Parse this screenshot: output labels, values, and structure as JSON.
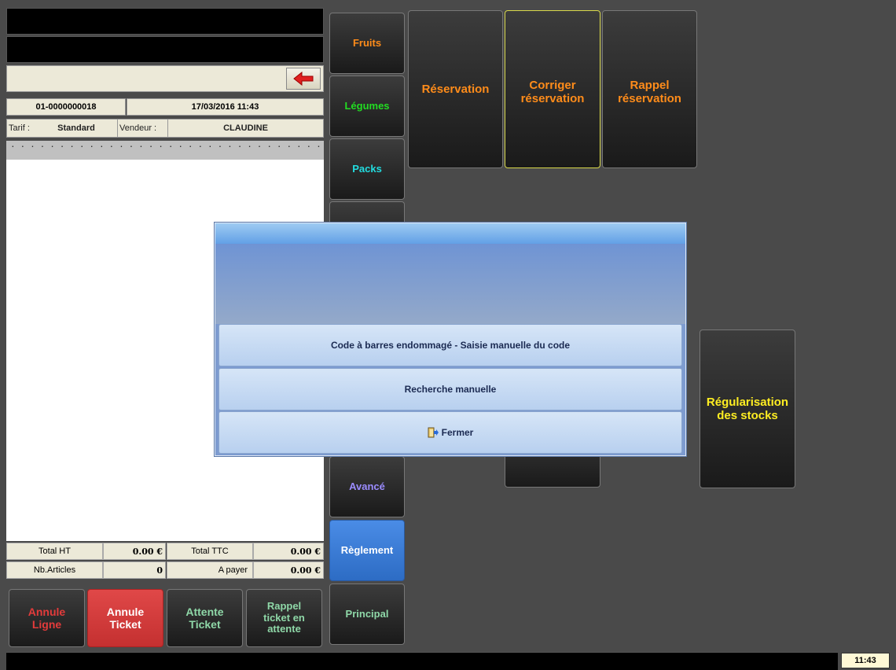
{
  "ticket": {
    "number": "01-0000000018",
    "datetime": "17/03/2016 11:43",
    "tarif_label": "Tarif :",
    "tarif_value": "Standard",
    "vendeur_label": "Vendeur :",
    "vendeur_value": "CLAUDINE",
    "dots": "· · · · · · · · · · · · · · · · · · · · · · · · · · · · · · · · · · · · · · ·"
  },
  "totals": {
    "total_ht_label": "Total HT",
    "total_ht_value": "0.00 €",
    "total_ttc_label": "Total TTC",
    "total_ttc_value": "0.00 €",
    "nb_articles_label": "Nb.Articles",
    "nb_articles_value": "0",
    "a_payer_label": "A payer",
    "a_payer_value": "0.00 €"
  },
  "bottom_buttons": {
    "annule_ligne": "Annule Ligne",
    "annule_ticket": "Annule Ticket",
    "attente_ticket": "Attente Ticket",
    "rappel_ticket": "Rappel ticket en attente"
  },
  "categories": {
    "fruits": "Fruits",
    "legumes": "Légumes",
    "packs": "Packs",
    "avance": "Avancé",
    "reglement": "Règlement",
    "principal": "Principal"
  },
  "functions": {
    "reservation": "Réservation",
    "corriger_reservation": "Corriger réservation",
    "rappel_reservation": "Rappel réservation",
    "regularisation": "Régularisation des stocks"
  },
  "modal": {
    "option1": "Code à barres endommagé - Saisie manuelle du code",
    "option2": "Recherche manuelle",
    "close": "Fermer"
  },
  "status": {
    "clock": "11:43"
  },
  "colors": {
    "orange": "#ff8c1a",
    "green": "#22dd22",
    "cyan": "#22dde0",
    "purple": "#9b8cff",
    "yellow": "#ffee22",
    "red_text": "#e33b3b",
    "red_bg": "#d63a3a",
    "blue_bg": "#3d7fd8",
    "mint": "#8fd8a8"
  }
}
